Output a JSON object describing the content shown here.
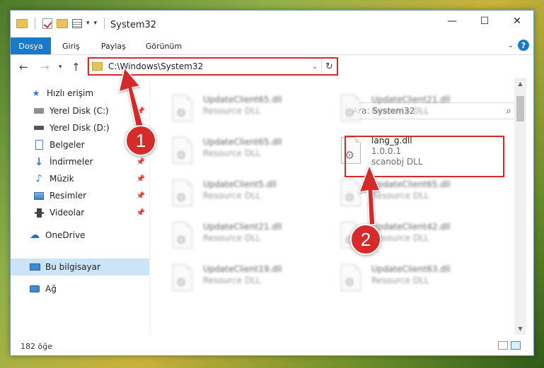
{
  "window": {
    "title": "System32",
    "controls": {
      "minimize": "—",
      "maximize": "☐",
      "close": "✕"
    }
  },
  "ribbon": {
    "tabs": [
      "Dosya",
      "Giriş",
      "Paylaş",
      "Görünüm"
    ]
  },
  "address": {
    "path": "C:\\Windows\\System32",
    "search_placeholder": "Ara: System32"
  },
  "sidebar": {
    "items": [
      {
        "label": "Hızlı erişim",
        "icon": "star-icon"
      },
      {
        "label": "Yerel Disk (C:)",
        "icon": "drive-icon",
        "pinned": true
      },
      {
        "label": "Yerel Disk (D:)",
        "icon": "drive-icon",
        "pinned": true
      },
      {
        "label": "Belgeler",
        "icon": "documents-icon",
        "pinned": true
      },
      {
        "label": "İndirmeler",
        "icon": "download-icon",
        "pinned": true
      },
      {
        "label": "Müzik",
        "icon": "music-icon",
        "pinned": true
      },
      {
        "label": "Resimler",
        "icon": "pictures-icon",
        "pinned": true
      },
      {
        "label": "Videolar",
        "icon": "video-icon",
        "pinned": true
      },
      {
        "label": "OneDrive",
        "icon": "cloud-icon"
      },
      {
        "label": "Bu bilgisayar",
        "icon": "computer-icon",
        "selected": true
      },
      {
        "label": "Ağ",
        "icon": "network-icon"
      }
    ]
  },
  "files": {
    "left": [
      {
        "name": "UpdateClient65.dll",
        "desc": "Resource DLL"
      },
      {
        "name": "UpdateClient65.dll",
        "desc": "Resource DLL"
      },
      {
        "name": "UpdateClient5.dll",
        "desc": "Resource DLL"
      },
      {
        "name": "UpdateClient21.dll",
        "desc": "Resource DLL"
      },
      {
        "name": "UpdateClient19.dll",
        "desc": "Resource DLL"
      }
    ],
    "right": [
      {
        "name": "UpdateClient21.dll",
        "desc": "Resource DLL"
      },
      {
        "name": "lang_g.dll",
        "desc": "1.0.0.1",
        "desc2": "scanobj DLL",
        "highlight": true
      },
      {
        "name": "UpdateClient65.dll",
        "desc": "Resource DLL"
      },
      {
        "name": "UpdateClient42.dll",
        "desc": "Resource DLL"
      },
      {
        "name": "UpdateClient63.dll",
        "desc": "Resource DLL"
      }
    ]
  },
  "status": {
    "count": "182 öğe"
  },
  "annotations": {
    "step1": "1",
    "step2": "2"
  },
  "colors": {
    "accent": "#1979ca",
    "highlight": "#d52b2b",
    "selected": "#cce4f7"
  }
}
